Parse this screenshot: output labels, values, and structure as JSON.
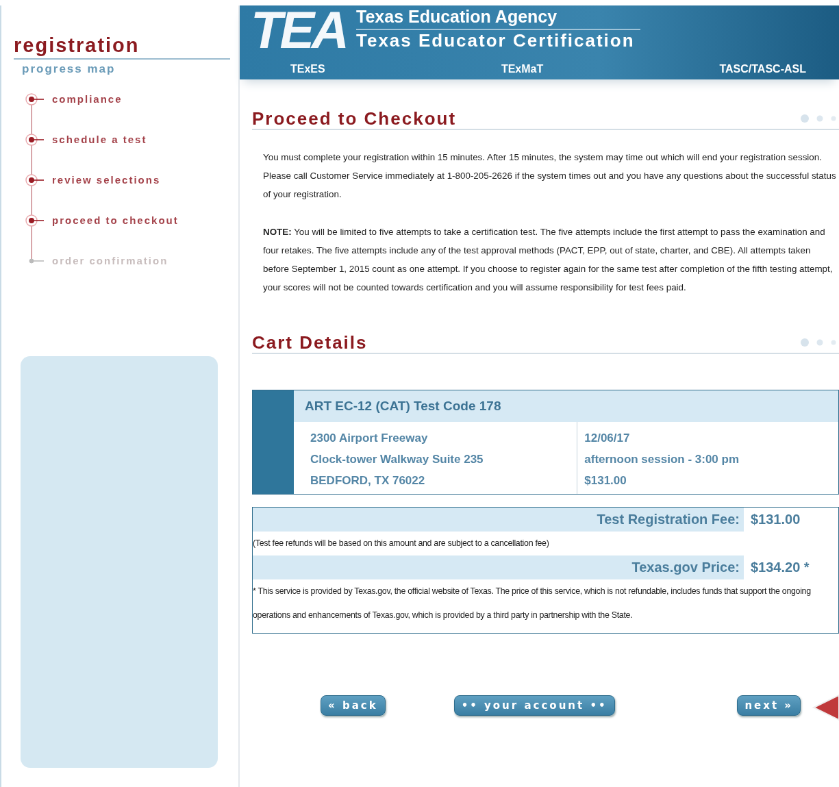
{
  "sidebar": {
    "title": "registration",
    "subtitle": "progress map",
    "steps": [
      {
        "label": "compliance",
        "completed": true
      },
      {
        "label": "schedule a test",
        "completed": true
      },
      {
        "label": "review selections",
        "completed": true
      },
      {
        "label": "proceed to checkout",
        "completed": true
      },
      {
        "label": "order confirmation",
        "completed": false
      }
    ]
  },
  "header": {
    "logo": "TEA",
    "agency": "Texas Education Agency",
    "program": "Texas Educator Certification",
    "links": [
      "TExES",
      "TExMaT",
      "TASC/TASC-ASL"
    ]
  },
  "checkout": {
    "title": "Proceed to Checkout",
    "paragraphs": [
      "You must complete your registration within 15 minutes. After 15 minutes, the system may time out which will end your registration session. Please call Customer Service immediately at 1-800-205-2626 if the system times out and you have any questions about the successful status of your registration.",
      "**NOTE:** You will be limited to five attempts to take a certification test. The five attempts include the first attempt to pass the examination and four retakes. The five attempts include any of the test approval methods (PACT, EPP, out of state, charter, and CBE). All attempts taken before September 1, 2015 count as one attempt. If you choose to register again for the same test after completion of the fifth testing attempt, your scores will not be counted towards certification and you will assume responsibility for test fees paid."
    ]
  },
  "cart": {
    "title": "Cart Details",
    "item": {
      "name": "ART EC-12 (CAT) Test Code 178",
      "address": [
        "2300 Airport Freeway",
        "Clock-tower Walkway Suite 235",
        "BEDFORD, TX 76022"
      ],
      "session": [
        "12/06/17",
        "afternoon session - 3:00 pm",
        "$131.00"
      ]
    },
    "fees": [
      {
        "label": "Test Registration Fee:",
        "amount": "$131.00",
        "note": "(Test fee refunds will be based on this amount and are subject to a cancellation fee)"
      },
      {
        "label": "Texas.gov Price:",
        "amount": "$134.20 *",
        "note": "* This service is provided by Texas.gov, the official website of Texas. The price of this service, which is not refundable, includes funds that support the ongoing operations and enhancements of Texas.gov, which is provided by a third party in partnership with the State."
      }
    ]
  },
  "buttons": [
    {
      "label": "« back",
      "kind": "back"
    },
    {
      "label": "•• your account ••",
      "kind": "account"
    },
    {
      "label": "next »",
      "kind": "next"
    }
  ]
}
